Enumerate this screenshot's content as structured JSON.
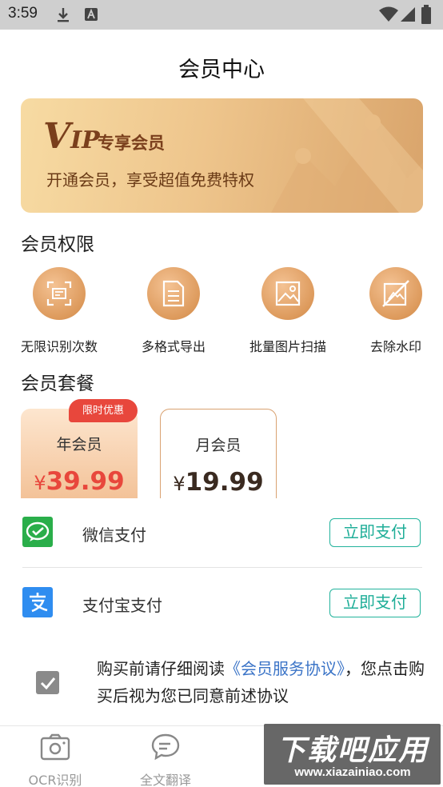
{
  "status_bar": {
    "time": "3:59"
  },
  "header": {
    "title": "会员中心"
  },
  "vip_banner": {
    "logo_v": "V",
    "logo_ip": "IP",
    "subtitle": "专享会员",
    "description": "开通会员，享受超值免费特权"
  },
  "benefits": {
    "title": "会员权限",
    "items": [
      {
        "label": "无限识别次数",
        "icon": "scan-icon"
      },
      {
        "label": "多格式导出",
        "icon": "document-icon"
      },
      {
        "label": "批量图片扫描",
        "icon": "image-icon"
      },
      {
        "label": "去除水印",
        "icon": "no-watermark-icon"
      }
    ]
  },
  "packages": {
    "title": "会员套餐",
    "badge": "限时优惠",
    "items": [
      {
        "name": "年会员",
        "currency": "¥",
        "price": "39.99",
        "selected": true
      },
      {
        "name": "月会员",
        "currency": "¥",
        "price": "19.99",
        "selected": false
      }
    ]
  },
  "payment": {
    "methods": [
      {
        "label": "微信支付",
        "button": "立即支付",
        "icon": "wechat-pay-icon",
        "color": "#2aae4a"
      },
      {
        "label": "支付宝支付",
        "button": "立即支付",
        "icon": "alipay-icon",
        "color": "#2f8df0"
      }
    ],
    "accent_color": "#1fae98"
  },
  "agreement": {
    "prefix": "购买前请仔细阅读",
    "link": "《会员服务协议》",
    "suffix": "，您点击购买后视为您已同意前述协议",
    "checked": true
  },
  "bottom_nav": {
    "items": [
      {
        "label": "OCR识别",
        "icon": "camera-icon"
      },
      {
        "label": "全文翻译",
        "icon": "chat-translate-icon"
      }
    ]
  },
  "watermark": {
    "title": "下载吧应用",
    "url": "www.xiazainiao.com"
  }
}
